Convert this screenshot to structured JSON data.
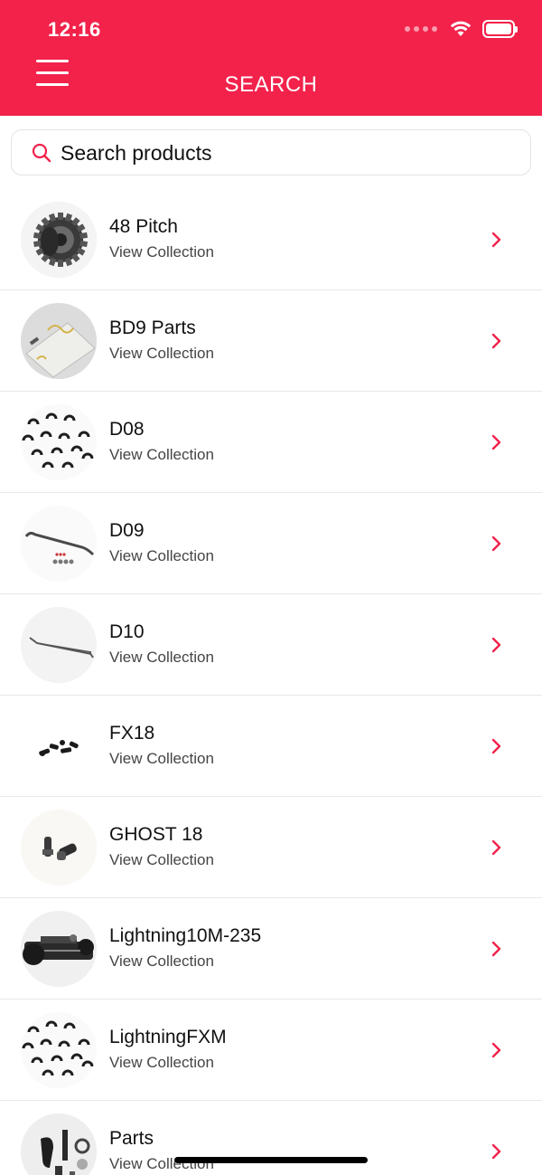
{
  "status_bar": {
    "time": "12:16"
  },
  "header": {
    "title": "SEARCH"
  },
  "search": {
    "placeholder": "Search products"
  },
  "colors": {
    "accent": "#F2224B"
  },
  "collections": [
    {
      "title": "48 Pitch",
      "subtitle": "View Collection",
      "image": "gear-image"
    },
    {
      "title": "BD9 Parts",
      "subtitle": "View Collection",
      "image": "decal-sheet-image"
    },
    {
      "title": "D08",
      "subtitle": "View Collection",
      "image": "e-clips-image"
    },
    {
      "title": "D09",
      "subtitle": "View Collection",
      "image": "sway-bar-image"
    },
    {
      "title": "D10",
      "subtitle": "View Collection",
      "image": "wire-rod-image"
    },
    {
      "title": "FX18",
      "subtitle": "View Collection",
      "image": "screws-image"
    },
    {
      "title": "GHOST 18",
      "subtitle": "View Collection",
      "image": "axle-parts-image"
    },
    {
      "title": "Lightning10M-235",
      "subtitle": "View Collection",
      "image": "chassis-image"
    },
    {
      "title": "LightningFXM",
      "subtitle": "View Collection",
      "image": "e-clips-image"
    },
    {
      "title": "Parts",
      "subtitle": "View Collection",
      "image": "parts-set-image"
    }
  ]
}
